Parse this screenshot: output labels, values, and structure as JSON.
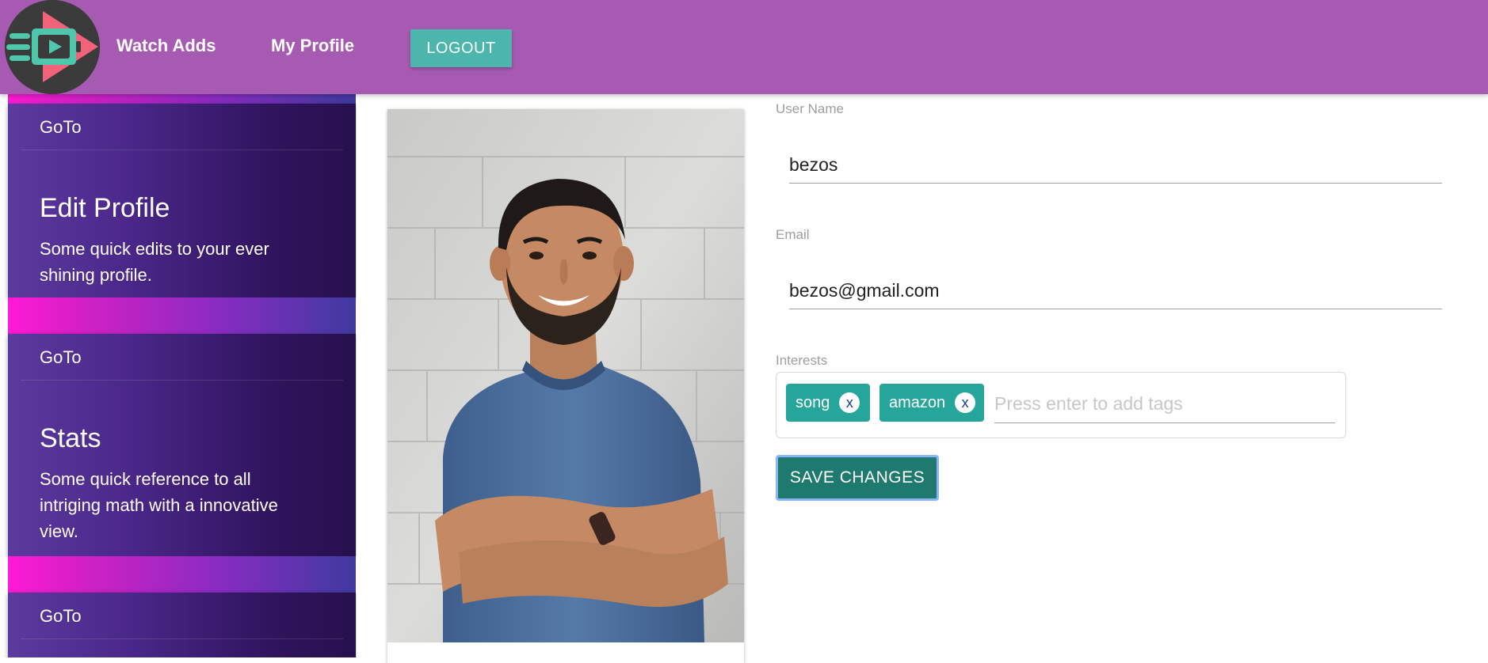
{
  "colors": {
    "navbar": "#a75ab2",
    "logout_button": "#4db6ac",
    "tag_chip": "#26a69a",
    "save_button": "#1e7a6e",
    "card_gradient_start": "#5c3a9e",
    "card_gradient_end": "#27104e",
    "strip_pink": "#ff1ad6"
  },
  "navbar": {
    "logo_icon": "play-video-logo-icon",
    "links": {
      "watch_adds": "Watch Adds",
      "my_profile": "My Profile"
    },
    "logout_label": "LOGOUT"
  },
  "sidebar": {
    "cards": [
      {
        "goto_label": "GoTo",
        "title": "Edit Profile",
        "description": "Some quick edits to your ever shining profile."
      },
      {
        "goto_label": "GoTo",
        "title": "Stats",
        "description": "Some quick reference to all intriging math with a innovative view."
      },
      {
        "goto_label": "GoTo"
      }
    ]
  },
  "profile_form": {
    "username": {
      "label": "User Name",
      "value": "bezos"
    },
    "email": {
      "label": "Email",
      "value": "bezos@gmail.com"
    },
    "interests": {
      "label": "Interests",
      "tags": [
        {
          "label": "song",
          "remove_label": "x"
        },
        {
          "label": "amazon",
          "remove_label": "x"
        }
      ],
      "placeholder": "Press enter to add tags"
    },
    "save_label": "SAVE CHANGES"
  }
}
